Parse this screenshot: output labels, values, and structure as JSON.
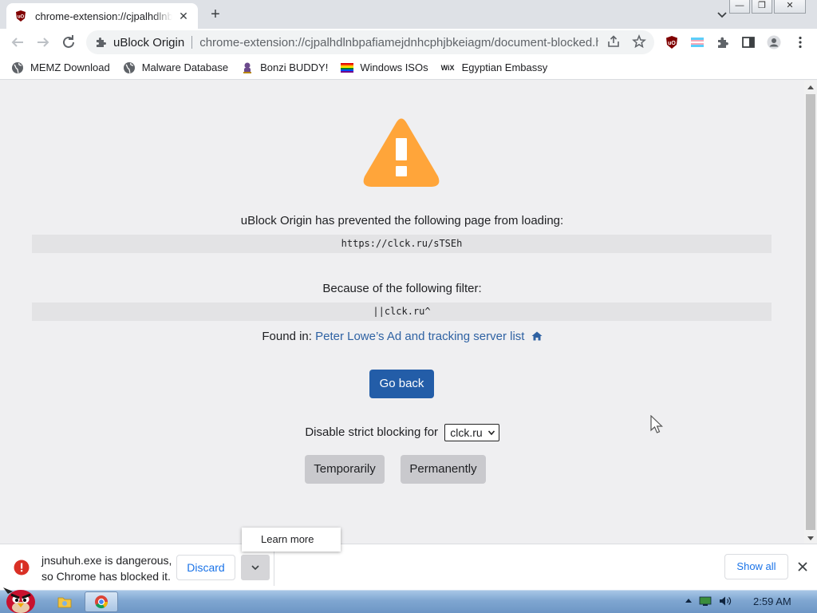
{
  "browser": {
    "tab": {
      "title": "chrome-extension://cjpalhdlnbpafiamejdnhcphjbkeiagm",
      "close_glyph": "✕"
    },
    "new_tab_glyph": "+",
    "window_buttons": [
      "—",
      "❐",
      "✕"
    ],
    "omnibox": {
      "site_name": "uBlock Origin",
      "url": "chrome-extension://cjpalhdlnbpafiamejdnhcphjbkeiagm/document-blocked.html"
    },
    "bookmarks": [
      {
        "label": "MEMZ Download",
        "icon": "globe-icon"
      },
      {
        "label": "Malware Database",
        "icon": "globe-icon"
      },
      {
        "label": "Bonzi BUDDY!",
        "icon": "bonzi-icon"
      },
      {
        "label": "Windows ISOs",
        "icon": "rainbow-flag-icon"
      },
      {
        "label": "Egyptian Embassy",
        "icon": "wix-icon"
      }
    ],
    "wix_text": "WiX"
  },
  "page": {
    "prevented_text": "uBlock Origin has prevented the following page from loading:",
    "blocked_url": "https://clck.ru/sTSEh",
    "filter_intro": "Because of the following filter:",
    "filter": "||clck.ru^",
    "found_in_label": "Found in:",
    "found_in_list": "Peter Lowe’s Ad and tracking server list",
    "go_back": "Go back",
    "disable_label": "Disable strict blocking for",
    "domain_selected": "clck.ru",
    "temporarily": "Temporarily",
    "permanently": "Permanently"
  },
  "download": {
    "message_line1": "jnsuhuh.exe is dangerous,",
    "message_line2": "so Chrome has blocked it.",
    "discard": "Discard",
    "learn_more": "Learn more",
    "show_all": "Show all"
  },
  "taskbar": {
    "clock": "2:59 AM"
  },
  "colors": {
    "warning_orange": "#ffa53a",
    "primary_button": "#235da8",
    "link": "#2f62a3",
    "danger_red": "#d93025"
  }
}
